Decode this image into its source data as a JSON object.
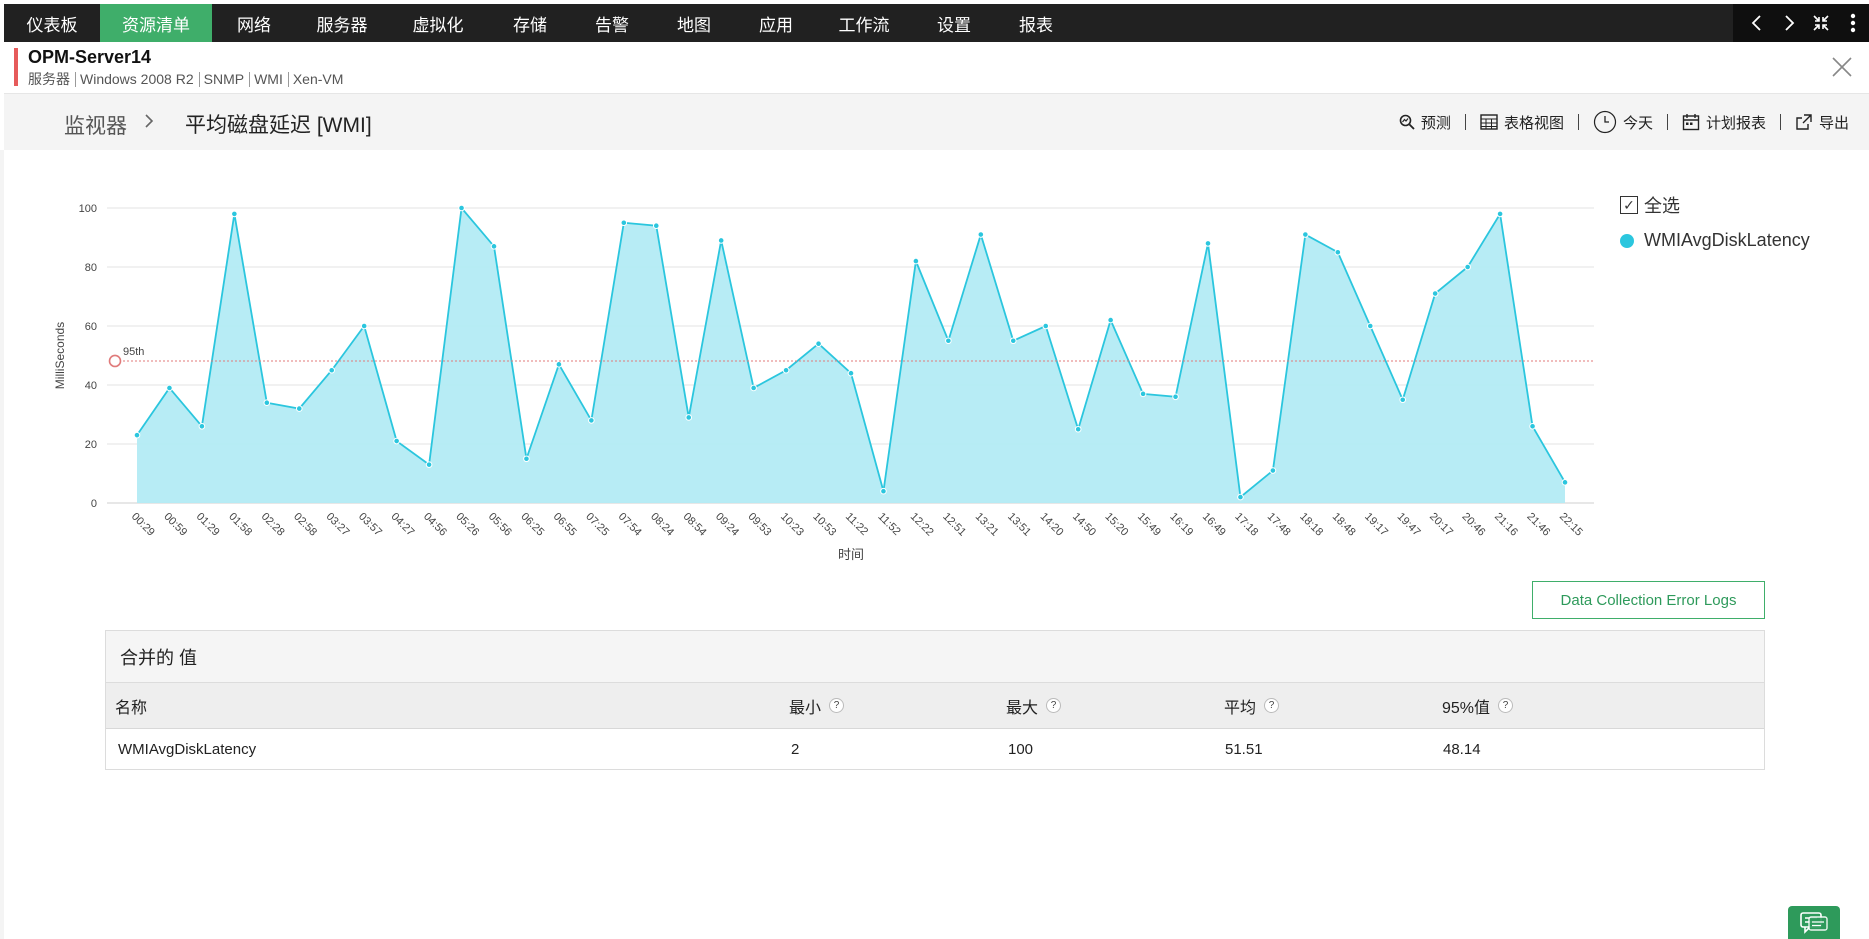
{
  "nav": {
    "items": [
      {
        "label": "仪表板",
        "width": 96
      },
      {
        "label": "资源清单",
        "width": 112,
        "active": true
      },
      {
        "label": "网络",
        "width": 84
      },
      {
        "label": "服务器",
        "width": 92
      },
      {
        "label": "虚拟化",
        "width": 100
      },
      {
        "label": "存储",
        "width": 84
      },
      {
        "label": "告警",
        "width": 80
      },
      {
        "label": "地图",
        "width": 84
      },
      {
        "label": "应用",
        "width": 80
      },
      {
        "label": "工作流",
        "width": 96
      },
      {
        "label": "设置",
        "width": 84
      },
      {
        "label": "报表",
        "width": 80
      }
    ],
    "controls": [
      "chevron-left-icon",
      "chevron-right-icon",
      "collapse-icon",
      "more-vertical-icon"
    ],
    "accent": "#3fae6a"
  },
  "device": {
    "name": "OPM-Server14",
    "tags": [
      "服务器",
      "Windows 2008 R2",
      "SNMP",
      "WMI",
      "Xen-VM"
    ]
  },
  "breadcrumb": {
    "root": "监视器",
    "title": "平均磁盘延迟 [WMI]"
  },
  "toolbar": {
    "forecast": "预测",
    "table_view": "表格视图",
    "today": "今天",
    "schedule_report": "计划报表",
    "export": "导出"
  },
  "legend": {
    "select_all": "全选",
    "series_name": "WMIAvgDiskLatency"
  },
  "chart_data": {
    "type": "area",
    "ylabel": "MilliSeconds",
    "xlabel": "时间",
    "ylim": [
      0,
      100
    ],
    "yticks": [
      0,
      20,
      40,
      60,
      80,
      100
    ],
    "grid": true,
    "legend": "right",
    "percentile_label": "95th",
    "percentile_value": 48.14,
    "color": "#2bc6de",
    "fill": "#b3ebf4",
    "x": [
      "00:29",
      "00:59",
      "01:29",
      "01:58",
      "02:28",
      "02:58",
      "03:27",
      "03:57",
      "04:27",
      "04:56",
      "05:26",
      "05:56",
      "06:25",
      "06:55",
      "07:25",
      "07:54",
      "08:24",
      "08:54",
      "09:24",
      "09:53",
      "10:23",
      "10:53",
      "11:22",
      "11:52",
      "12:22",
      "12:51",
      "13:21",
      "13:51",
      "14:20",
      "14:50",
      "15:20",
      "15:49",
      "16:19",
      "16:49",
      "17:18",
      "17:48",
      "18:18",
      "18:48",
      "19:17",
      "19:47",
      "20:17",
      "20:46",
      "21:16",
      "21:46",
      "22:15"
    ],
    "series": [
      {
        "name": "WMIAvgDiskLatency",
        "values": [
          23,
          39,
          26,
          98,
          34,
          32,
          45,
          60,
          21,
          13,
          100,
          87,
          15,
          47,
          28,
          95,
          94,
          29,
          89,
          39,
          45,
          54,
          44,
          4,
          82,
          55,
          91,
          55,
          60,
          25,
          62,
          37,
          36,
          88,
          2,
          11,
          91,
          85,
          60,
          35,
          71,
          80,
          98,
          26,
          7
        ]
      }
    ]
  },
  "error_logs_button": "Data Collection Error Logs",
  "summary": {
    "title": "合并的 值",
    "headers": {
      "name": "名称",
      "min": "最小",
      "max": "最大",
      "avg": "平均",
      "p95": "95%值"
    },
    "help": "?",
    "row": {
      "name": "WMIAvgDiskLatency",
      "min": "2",
      "max": "100",
      "avg": "51.51",
      "p95": "48.14"
    }
  }
}
